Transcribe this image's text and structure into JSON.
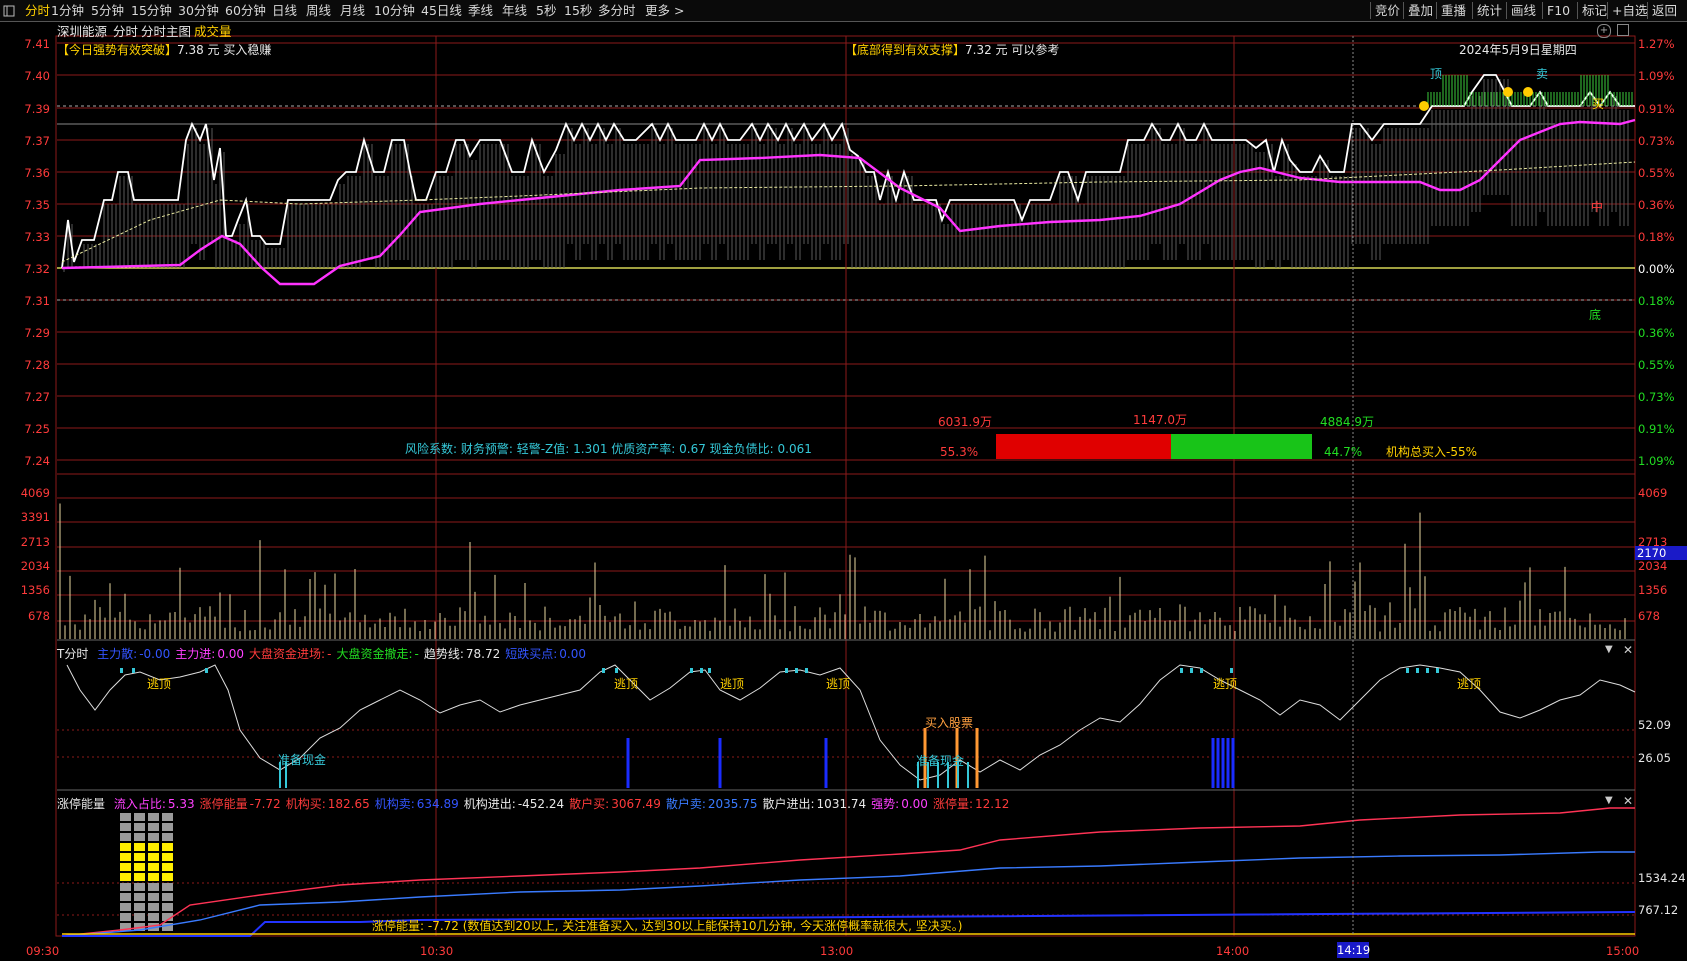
{
  "toolbar": {
    "left_icon": "menu-icon",
    "periods": [
      "分时",
      "1分钟",
      "5分钟",
      "15分钟",
      "30分钟",
      "60分钟",
      "日线",
      "周线",
      "月线",
      "10分钟",
      "45日线",
      "季线",
      "年线",
      "5秒",
      "15秒",
      "多分时",
      "更多 >"
    ],
    "active": "分时",
    "right_buttons": [
      "竞价",
      "叠加",
      "重播",
      "统计",
      "画线",
      "F10",
      "标记",
      "+自选",
      "返回"
    ]
  },
  "header": {
    "stock": "深圳能源",
    "mode": "分时",
    "sub": "分时主图",
    "volume_label": "成交量",
    "signal_left_bracket": "【今日强势有效突破】",
    "signal_left_text": "7.38 元 买入稳赚",
    "signal_mid_bracket": "【底部得到有效支撑】",
    "signal_mid_text": "7.32 元 可以参考",
    "date": "2024年5月9日星期四"
  },
  "price_axis": {
    "left": [
      "7.41",
      "7.40",
      "7.39",
      "7.37",
      "7.36",
      "7.35",
      "7.33",
      "7.32",
      "7.31",
      "7.29",
      "7.28",
      "7.27",
      "7.25",
      "7.24"
    ],
    "right": [
      "1.27%",
      "1.09%",
      "0.91%",
      "0.73%",
      "0.55%",
      "0.36%",
      "0.18%",
      "0.00%",
      "0.18%",
      "0.36%",
      "0.55%",
      "0.73%",
      "0.91%",
      "1.09%"
    ]
  },
  "markers": {
    "mid": "中",
    "bottom": "底",
    "sell": "卖",
    "top": "顶",
    "buy": "买"
  },
  "risk": {
    "line": "风险系数: 财务预警: 轻警-Z值: 1.301 优质资产率: 0.67 现金负债比: 0.061"
  },
  "fund_bar": {
    "left_amount": "6031.9万",
    "mid_amount": "1147.0万",
    "right_amount": "4884.9万",
    "left_pct": "55.3%",
    "right_pct": "44.7%",
    "buy_ratio": 0.553,
    "summary": "机构总买入-55%"
  },
  "volume_axis": {
    "left": [
      "4069",
      "3391",
      "2713",
      "2034",
      "1356",
      "678"
    ],
    "right": [
      "4069",
      "2713",
      "2034",
      "1356",
      "678"
    ],
    "current": "2170"
  },
  "indicator1": {
    "name": "T分时",
    "items": [
      {
        "label": "主力散:",
        "value": "-0.00",
        "color": "#3355ff"
      },
      {
        "label": "主力进:",
        "value": "0.00",
        "color": "#ff40ff"
      },
      {
        "label": "大盘资金进场:",
        "value": "-",
        "color": "#ff3b3b"
      },
      {
        "label": "大盘资金撤走:",
        "value": "-",
        "color": "#22dd22"
      },
      {
        "label": "趋势线:",
        "value": "78.72",
        "color": "#e8e8e8"
      },
      {
        "label": "短跌买点:",
        "value": "0.00",
        "color": "#3355ff"
      }
    ],
    "labels": [
      "逃顶",
      "准备现金",
      "买入股票",
      "准备现金"
    ],
    "axis": [
      "52.09",
      "26.05"
    ]
  },
  "indicator2": {
    "name": "涨停能量",
    "items": [
      {
        "label": "流入占比:",
        "value": "5.33",
        "color": "#ff40ff"
      },
      {
        "label": "涨停能量",
        "value": "-7.72",
        "color": "#ff3b3b"
      },
      {
        "label": "机构买:",
        "value": "182.65",
        "color": "#ff3b3b"
      },
      {
        "label": "机构卖:",
        "value": "634.89",
        "color": "#3355ff"
      },
      {
        "label": "机构进出:",
        "value": "-452.24",
        "color": "#e8e8e8"
      },
      {
        "label": "散户买:",
        "value": "3067.49",
        "color": "#ff3b3b"
      },
      {
        "label": "散户卖:",
        "value": "2035.75",
        "color": "#3a7bff"
      },
      {
        "label": "散户进出:",
        "value": "1031.74",
        "color": "#e8e8e8"
      },
      {
        "label": "强势:",
        "value": "0.00",
        "color": "#ff40ff"
      },
      {
        "label": "涨停量:",
        "value": "12.12",
        "color": "#ff3b3b"
      }
    ],
    "axis": [
      "1534.24",
      "767.12"
    ],
    "note": "涨停能量: -7.72 (数值达到20以上, 关注准备买入, 达到30以上能保持10几分钟, 今天涨停概率就很大, 坚决买。)"
  },
  "time_axis": [
    "09:30",
    "10:30",
    "13:00",
    "14:00",
    "15:00"
  ],
  "cursor_time": "14:19",
  "colors": {
    "grid": "#8b1a1a",
    "price": "#ffffff",
    "avg": "#ff33ff",
    "rise": "#ff3b3b",
    "fall": "#22cc22",
    "axis_text": "#ff3b3b"
  },
  "panel_icons": [
    "dropdown-icon",
    "close-icon"
  ]
}
